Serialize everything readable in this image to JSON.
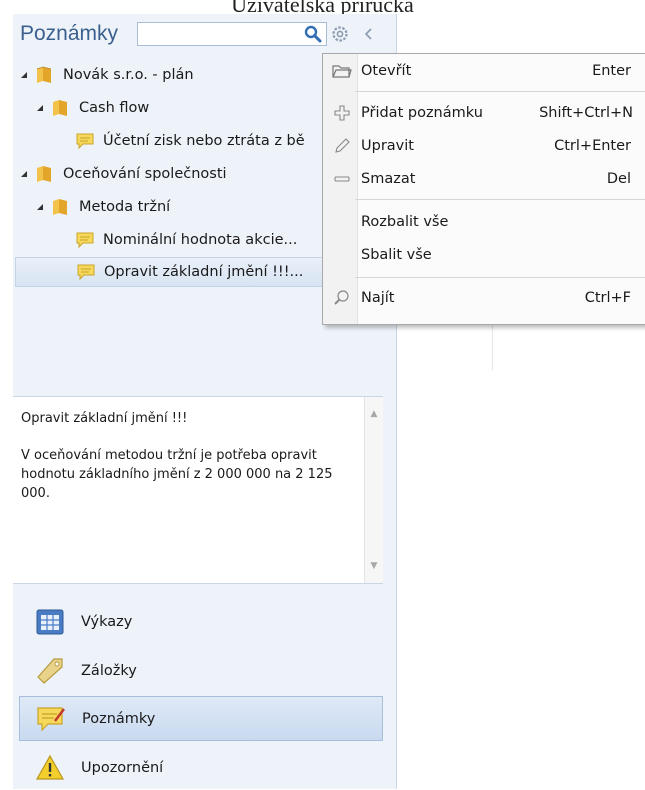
{
  "caption": "Uživatelská příručka",
  "panel": {
    "title": "Poznámky",
    "search": {
      "value": "",
      "placeholder": ""
    },
    "icons": [
      "search-icon",
      "gear-icon",
      "collapse-panel-icon"
    ]
  },
  "tree": [
    {
      "label": "Novák s.r.o. - plán",
      "type": "folder",
      "level": 0,
      "expanded": true
    },
    {
      "label": "Cash flow",
      "type": "folder",
      "level": 1,
      "expanded": true
    },
    {
      "label": "Účetní zisk nebo ztráta z bě",
      "type": "note",
      "level": 2
    },
    {
      "label": "Oceňování společnosti",
      "type": "folder",
      "level": 0,
      "expanded": true
    },
    {
      "label": "Metoda tržní",
      "type": "folder",
      "level": 1,
      "expanded": true
    },
    {
      "label": "Nominální hodnota akcie...",
      "type": "note",
      "level": 2
    },
    {
      "label": "Opravit základní jmění !!!...",
      "type": "note",
      "level": 2,
      "selected": true
    }
  ],
  "preview": {
    "title": "Opravit základní jmění !!!",
    "body": "V oceňování metodou tržní je potřeba opravit hodnotu základního jmění z 2 000 000 na 2 125 000."
  },
  "nav": [
    {
      "label": "Výkazy",
      "icon": "reports-icon"
    },
    {
      "label": "Záložky",
      "icon": "bookmark-tag-icon"
    },
    {
      "label": "Poznámky",
      "icon": "notes-icon",
      "active": true
    },
    {
      "label": "Upozornění",
      "icon": "warning-icon"
    }
  ],
  "context_menu": [
    {
      "label": "Otevřít",
      "shortcut": "Enter",
      "icon": "open-folder-icon"
    },
    {
      "label": "Přidat poznámku",
      "shortcut": "Shift+Ctrl+N",
      "icon": "plus-icon"
    },
    {
      "label": "Upravit",
      "shortcut": "Ctrl+Enter",
      "icon": "pencil-icon"
    },
    {
      "label": "Smazat",
      "shortcut": "Del",
      "icon": "minus-icon"
    },
    {
      "label": "Rozbalit vše",
      "shortcut": "",
      "icon": ""
    },
    {
      "label": "Sbalit vše",
      "shortcut": "",
      "icon": ""
    },
    {
      "label": "Najít",
      "shortcut": "Ctrl+F",
      "icon": "magnifier-icon"
    }
  ],
  "colors": {
    "title": "#3b5f8f",
    "panel_bg": "#eef3fa",
    "selection": "#d8e4f3",
    "folder": "#e8b030",
    "note": "#f2d35a"
  }
}
